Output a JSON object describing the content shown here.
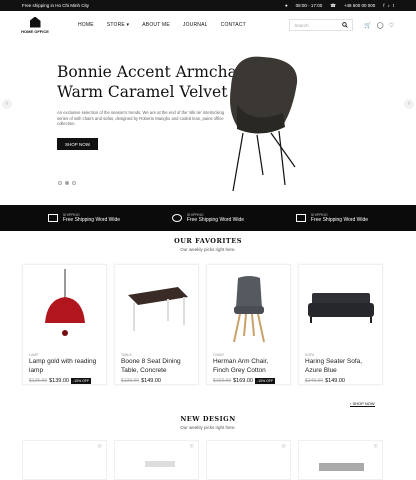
{
  "topbar": {
    "message": "Free shipping in Ho Chi Minh City",
    "hours": "08:00 - 17:00",
    "phone": "+48 500 00 000"
  },
  "header": {
    "logo": "HOME OFFICE",
    "nav": [
      "HOME",
      "STORE",
      "ABOUT ME",
      "JOURNAL",
      "CONTACT"
    ],
    "search_placeholder": "Search"
  },
  "hero": {
    "title_line1": "Bonnie Accent Armchair",
    "title_line2": "Warm Caramel Velvet",
    "description": "An exclusive selection of the season's trends. We are at the end of the 'silk tie' interlocking series of with chairs and sofas, designed by Roberto Mangho and coded lean, pains office collection.",
    "button": "SHOP NOW",
    "prev": "‹",
    "next": "›"
  },
  "features": [
    {
      "small": "SHIPPING",
      "big": "Free Shipping Word Wide"
    },
    {
      "small": "SHIPPING",
      "big": "Free Shipping Word Wide"
    },
    {
      "small": "SHIPPING",
      "big": "Free Shipping Word Wide"
    }
  ],
  "favorites": {
    "title": "OUR FAVORITES",
    "subtitle": "Our weekly picks right here.",
    "products": [
      {
        "category": "LAMP",
        "name": "Lamp gold with reading lamp",
        "old_price": "$125.00",
        "price": "$139.00",
        "badge": "-10% OFF"
      },
      {
        "category": "TABLE",
        "name": "Boone 8 Seat Dining Table, Concrete",
        "old_price": "$139.00",
        "price": "$149.00",
        "badge": ""
      },
      {
        "category": "CHAIR",
        "name": "Herman Arm Chair, Finch Grey Cotton",
        "old_price": "$169.00",
        "price": "$169.00",
        "badge": "-10% OFF"
      },
      {
        "category": "SOFA",
        "name": "Haring Seater Sofa, Azure Blue",
        "old_price": "$149.00",
        "price": "$149.00",
        "badge": ""
      }
    ],
    "shop_now": "SHOP NOW"
  },
  "new_design": {
    "title": "NEW DESIGN",
    "subtitle": "Our weekly picks right here."
  }
}
